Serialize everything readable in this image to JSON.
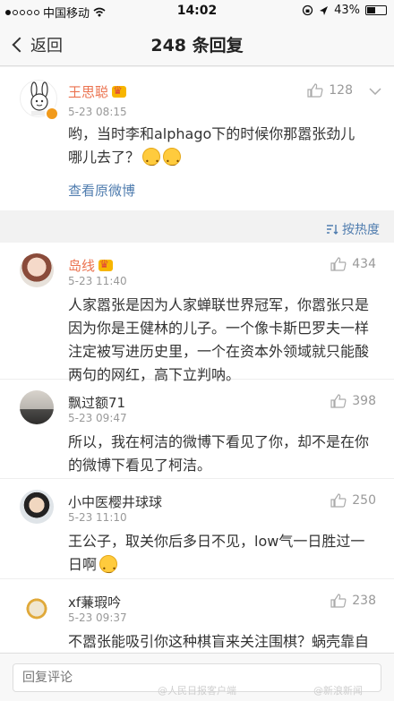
{
  "status": {
    "carrier": "中国移动",
    "time": "14:02",
    "battery": "43%",
    "battery_level": 0.43,
    "signal_dots": [
      true,
      false,
      false,
      false,
      false
    ]
  },
  "nav": {
    "back": "返回",
    "title": "248 条回复"
  },
  "original": {
    "name": "王思聪",
    "time": "5-23 08:15",
    "likes": "128",
    "text": "哟，当时李和alphago下的时候你那嚣张劲儿哪儿去了？",
    "view_original": "查看原微博",
    "name_color": "#eb7350"
  },
  "sort": {
    "label": "按热度"
  },
  "comments": [
    {
      "name": "岛线",
      "time": "5-23 11:40",
      "likes": "434",
      "text": "人家嚣张是因为人家蝉联世界冠军，你嚣张只是因为你是王健林的儿子。一个像卡斯巴罗夫一样注定被写进历史里，一个在资本外领域就只能酸两句的网红，高下立判呐。",
      "vip": true
    },
    {
      "name": "飘过额71",
      "time": "5-23 09:47",
      "likes": "398",
      "text": "所以，我在柯洁的微博下看见了你，却不是在你的微博下看见了柯洁。",
      "vip": false
    },
    {
      "name": "小中医樱井球球",
      "time": "5-23 11:10",
      "likes": "250",
      "text": "王公子，取关你后多日不见，low气一日胜过一日啊",
      "vip": false
    },
    {
      "name": "xf蒹瑕吟",
      "time": "5-23 09:37",
      "likes": "238",
      "text": "不嚣张能吸引你这种棋盲来关注围棋？蜗壳靠自己，而靠老子的钱嚣张！",
      "vip": false
    }
  ],
  "reply": {
    "placeholder": "回复评论"
  },
  "watermarks": [
    "@人民日报客户端",
    "@新浪新闻"
  ],
  "colors": {
    "vip_name": "#eb7350",
    "normal_name": "#333333",
    "link": "#507daf"
  }
}
